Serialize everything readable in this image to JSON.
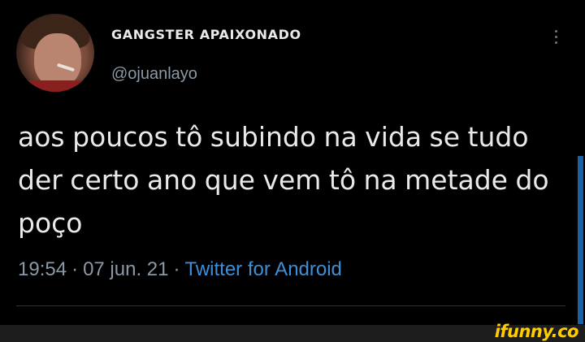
{
  "tweet": {
    "author": {
      "display_name": "GANGSTER APAIXONADO",
      "handle": "@ojuanlayo"
    },
    "text": "aos poucos tô subindo na vida se tudo der certo ano que vem tô na metade do poço",
    "time": "19:54",
    "separator": "·",
    "date": "07 jun. 21",
    "source": "Twitter for Android"
  },
  "watermark": "ifunny.co",
  "colors": {
    "background": "#000000",
    "text": "#e7e9ea",
    "secondary": "#8b98a5",
    "link": "#3f8fd6",
    "watermark": "#ffcc00"
  },
  "icons": {
    "more": "more-vertical-icon"
  }
}
